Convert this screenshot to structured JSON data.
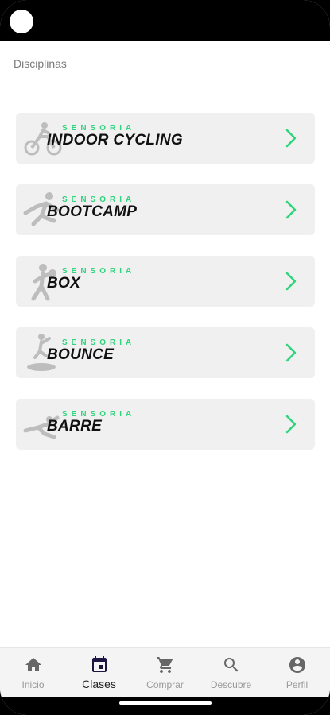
{
  "header": {
    "title": "Disciplinas"
  },
  "classes": [
    {
      "brand": "SENSORIA",
      "title": "INDOOR CYCLING",
      "icon": "cyclist-icon"
    },
    {
      "brand": "SENSORIA",
      "title": "BOOTCAMP",
      "icon": "runner-icon"
    },
    {
      "brand": "SENSORIA",
      "title": "BOX",
      "icon": "boxer-icon"
    },
    {
      "brand": "SENSORIA",
      "title": "BOUNCE",
      "icon": "trampoline-icon"
    },
    {
      "brand": "SENSORIA",
      "title": "BARRE",
      "icon": "dancer-icon"
    }
  ],
  "nav": [
    {
      "label": "Inicio",
      "icon": "home-icon",
      "active": false
    },
    {
      "label": "Clases",
      "icon": "calendar-icon",
      "active": true
    },
    {
      "label": "Comprar",
      "icon": "cart-icon",
      "active": false
    },
    {
      "label": "Descubre",
      "icon": "search-icon",
      "active": false
    },
    {
      "label": "Perfil",
      "icon": "profile-icon",
      "active": false
    }
  ],
  "colors": {
    "accent": "#2fd47c",
    "card_bg": "#f0f0f0",
    "nav_bg": "#f4f4f4"
  }
}
